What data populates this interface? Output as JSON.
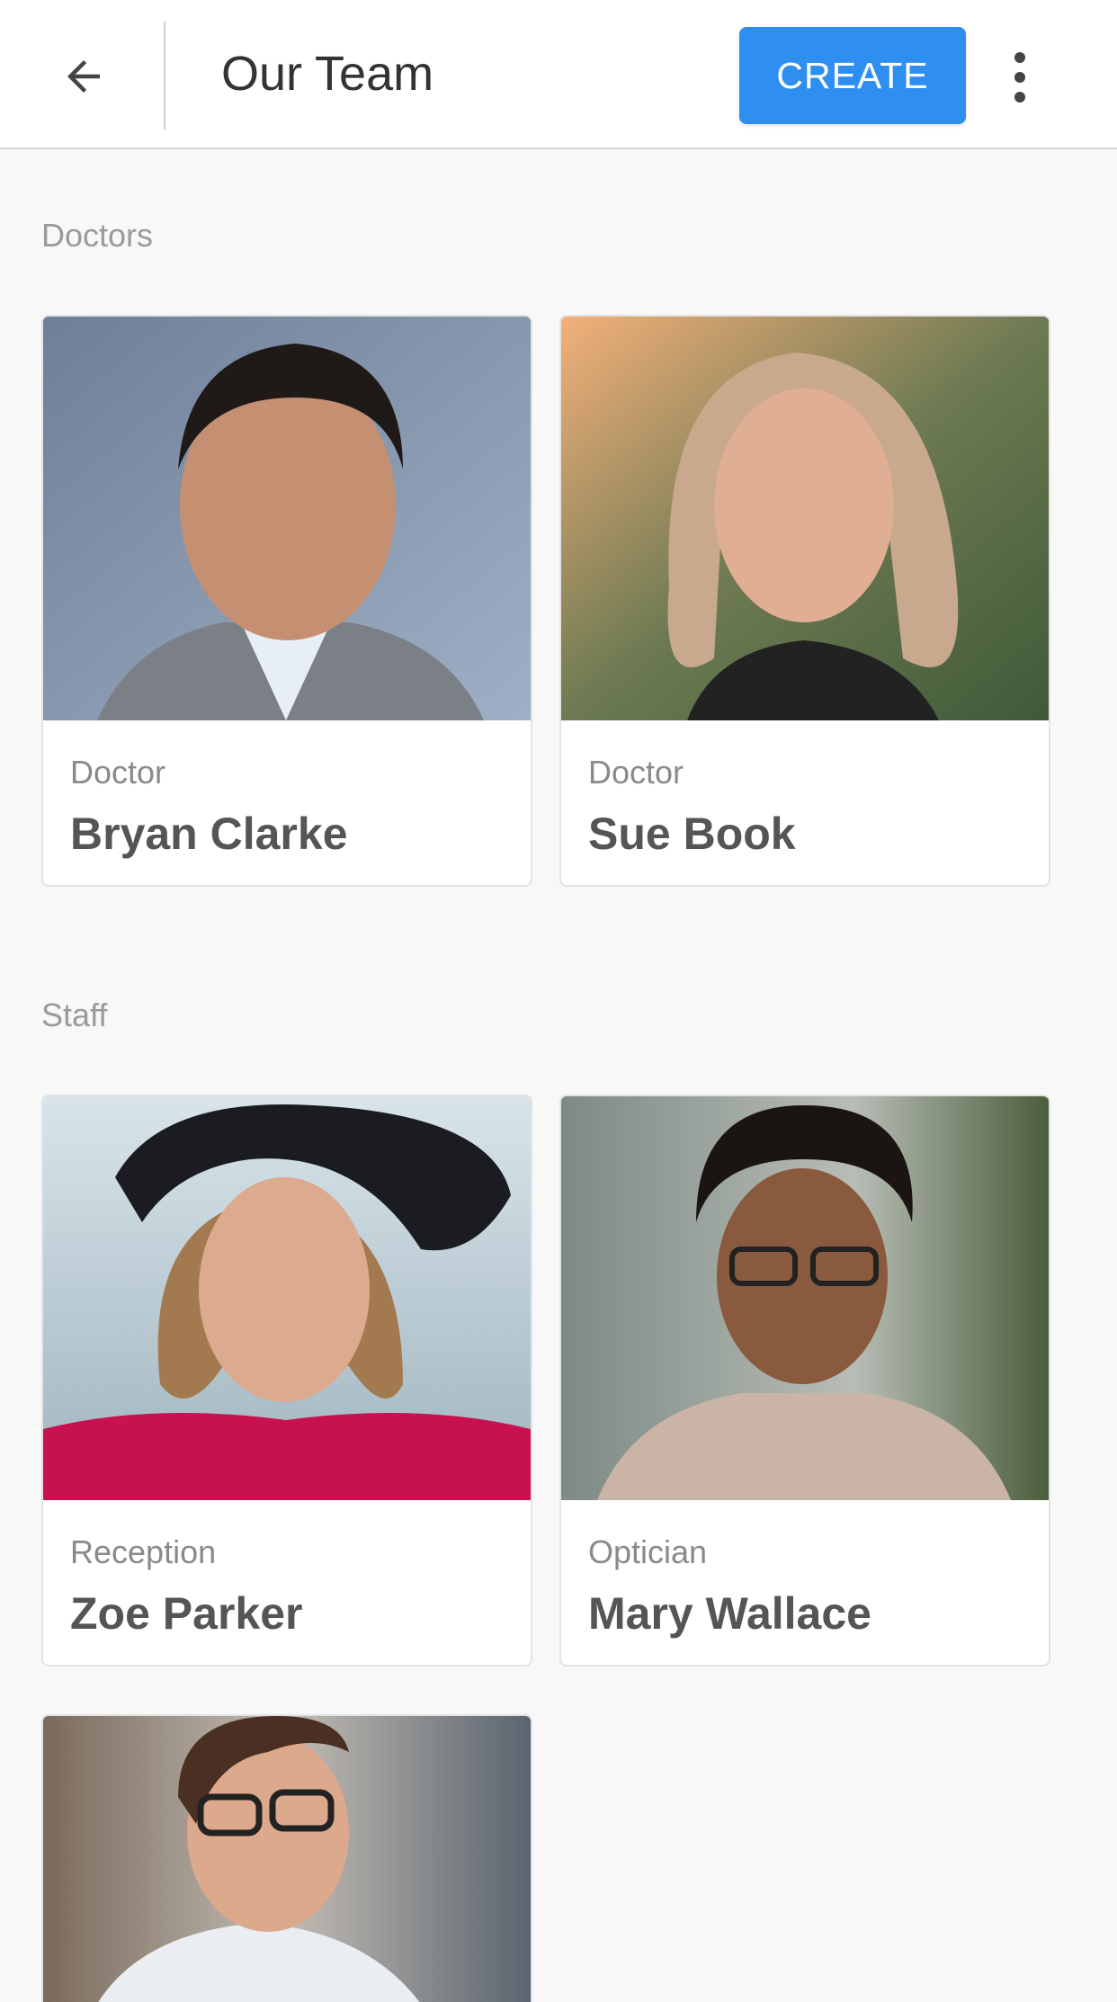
{
  "header": {
    "back_icon": "arrow-left-icon",
    "title": "Our Team",
    "create_label": "CREATE",
    "more_icon": "more-vert-icon",
    "accent_color": "#2f8ff0"
  },
  "sections": [
    {
      "title": "Doctors",
      "members": [
        {
          "role": "Doctor",
          "name": "Bryan Clarke",
          "photo": "portrait-photo"
        },
        {
          "role": "Doctor",
          "name": "Sue Book",
          "photo": "portrait-photo"
        }
      ]
    },
    {
      "title": "Staff",
      "members": [
        {
          "role": "Reception",
          "name": "Zoe Parker",
          "photo": "portrait-photo"
        },
        {
          "role": "Optician",
          "name": "Mary Wallace",
          "photo": "portrait-photo"
        },
        {
          "photo": "portrait-photo"
        }
      ]
    }
  ]
}
